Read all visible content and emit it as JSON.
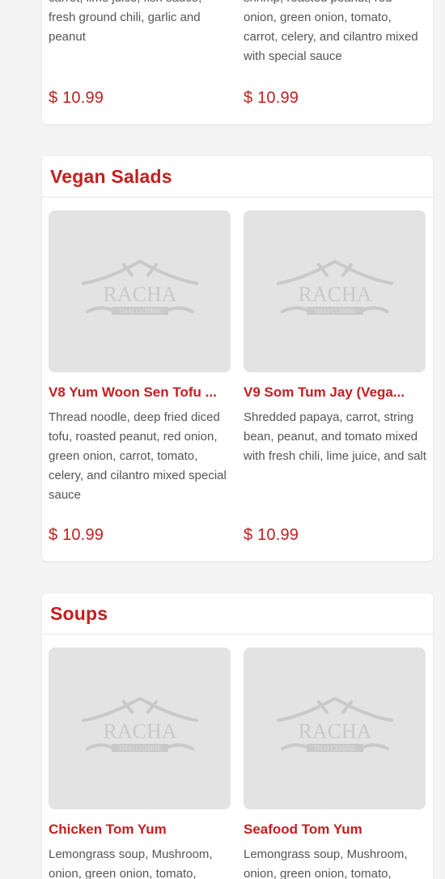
{
  "top_card": {
    "items": [
      {
        "desc": "carrot, lime juice, fish sauce, fresh ground chili, garlic and peanut",
        "price": "$ 10.99"
      },
      {
        "desc": "shrimp, roasted peanut, red onion, green onion, tomato, carrot, celery, and cilantro mixed with special sauce",
        "price": "$ 10.99"
      }
    ]
  },
  "vegan_salads": {
    "title": "Vegan Salads",
    "items": [
      {
        "name": "V8 Yum Woon Sen Tofu ...",
        "desc": "Thread noodle, deep fried diced tofu, roasted peanut, red onion, green onion, carrot, tomato, celery, and cilantro mixed special sauce",
        "price": "$ 10.99"
      },
      {
        "name": "V9 Som Tum Jay (Vega...",
        "desc": "Shredded papaya, carrot, string bean, peanut, and tomato mixed with fresh chili, lime juice, and salt",
        "price": "$ 10.99"
      }
    ]
  },
  "soups": {
    "title": "Soups",
    "items": [
      {
        "name": "Chicken Tom Yum",
        "desc": "Lemongrass soup, Mushroom, onion, green onion, tomato,"
      },
      {
        "name": "Seafood Tom Yum",
        "desc": "Lemongrass soup, Mushroom, onion, green onion, tomato,"
      }
    ]
  },
  "placeholder_logo": {
    "brand": "RACHA",
    "tagline": "THAI CUISINE",
    "icon": "racha-logo-icon"
  },
  "colors": {
    "accent": "#c41f1f",
    "background": "#f4f4f4",
    "card": "#ffffff",
    "thumb": "#e3e3e3",
    "text": "#555555"
  }
}
